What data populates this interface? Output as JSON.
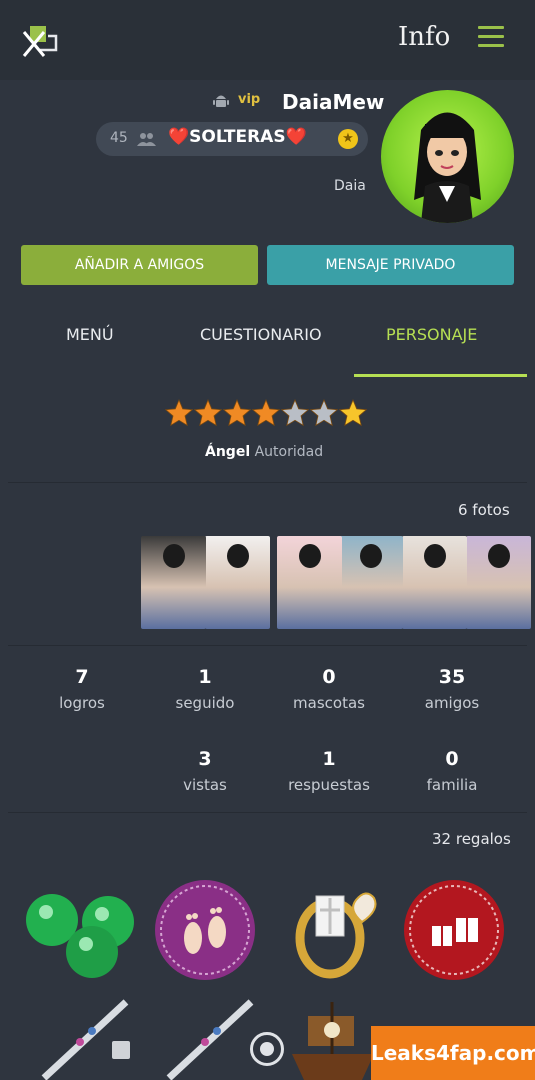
{
  "header": {
    "title": "Info"
  },
  "profile": {
    "username": "DaiaMew",
    "vip_label": "vip",
    "group_name": "❤️SOLTERAS❤️",
    "member_count": "45",
    "real_name": "Daia"
  },
  "actions": {
    "private_message_label": "MENSAJE PRIVADO",
    "add_friend_label": "AÑADIR A AMIGOS"
  },
  "tabs": [
    {
      "label": "PERSONAJE",
      "active": true
    },
    {
      "label": "CUESTIONARIO",
      "active": false
    },
    {
      "label": "MENÚ",
      "active": false
    }
  ],
  "rating": {
    "stars_filled": 5,
    "stars_total": 7,
    "authority_prefix": "Autoridad",
    "authority_value": "Ángel"
  },
  "photos": {
    "label": "6 fotos",
    "items": [
      {
        "bg": "#c9b6d8"
      },
      {
        "bg": "#e7e2dd"
      },
      {
        "bg": "#8fb4c9"
      },
      {
        "bg": "#f3d4d9"
      },
      {
        "bg": "#f2f0ef"
      },
      {
        "bg": "#3b3b3b"
      }
    ]
  },
  "stats": [
    {
      "value": "35",
      "label": "amigos"
    },
    {
      "value": "0",
      "label": "mascotas"
    },
    {
      "value": "1",
      "label": "seguido"
    },
    {
      "value": "7",
      "label": "logros"
    },
    {
      "value": "0",
      "label": "familia"
    },
    {
      "value": "1",
      "label": "respuestas"
    },
    {
      "value": "3",
      "label": "vistas"
    }
  ],
  "gifts": {
    "label": "32 regalos",
    "items": [
      {
        "icon": "gift-boxes-icon",
        "color": "#b3171f"
      },
      {
        "icon": "ring-icon",
        "color": "#d6a739"
      },
      {
        "icon": "footprints-icon",
        "color": "#8a2f86"
      },
      {
        "icon": "green-pearls-icon",
        "color": "#22b04f"
      }
    ]
  },
  "watermark": {
    "text": "Leaks4fap.com"
  },
  "colors": {
    "accent_green": "#b6df53",
    "teal_button": "#3aa0a7",
    "olive_button": "#8bae3b",
    "background": "#2f353f"
  }
}
